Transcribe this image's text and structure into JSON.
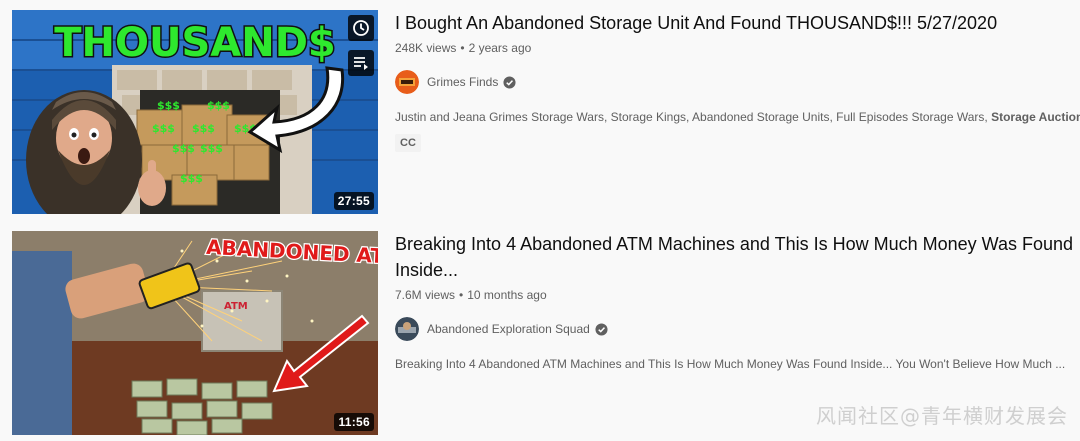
{
  "results": [
    {
      "title": "I Bought An Abandoned Storage Unit And Found THOUSAND$!!! 5/27/2020",
      "views": "248K views",
      "age": "2 years ago",
      "channel": "Grimes Finds",
      "verified": true,
      "description_plain": "Justin and Jeana Grimes Storage Wars, Storage Kings, Abandoned Storage Units, Full Episodes Storage Wars, ",
      "description_bold": "Storage Auctions",
      "badge": "CC",
      "duration": "27:55",
      "thumbnail_text": "THOUSAND$",
      "thumbnail_money_label": "$$$",
      "hover_icons": [
        "clock-icon",
        "add-to-queue-icon"
      ]
    },
    {
      "title": "Breaking Into 4 Abandoned ATM Machines and This Is How Much Money Was Found Inside...",
      "views": "7.6M views",
      "age": "10 months ago",
      "channel": "Abandoned Exploration Squad",
      "verified": true,
      "description_plain": "Breaking Into 4 Abandoned ATM Machines and This Is How Much Money Was Found Inside... You Won't Believe How Much ...",
      "duration": "11:56",
      "thumbnail_text": "ABANDONED ATM",
      "thumbnail_machine_label": "ATM"
    }
  ],
  "separator": "•",
  "watermark": "风闻社区@青年横财发展会",
  "colors": {
    "background": "#f9f9f9",
    "title": "#0f0f0f",
    "meta": "#606060",
    "thumb_green": "#2ee82e",
    "atm_red": "#e01a1a"
  }
}
